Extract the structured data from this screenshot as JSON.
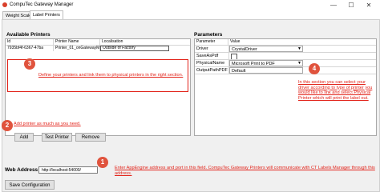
{
  "window": {
    "title": "CompuTec Gateway Manager",
    "minimize": "—",
    "maximize": "☐",
    "close": "✕"
  },
  "tabs": [
    {
      "label": "Weight Scales"
    },
    {
      "label": "Label Printers"
    }
  ],
  "available_printers": {
    "title": "Available Printers",
    "columns": [
      "Id",
      "Printer Name",
      "Localisation"
    ],
    "rows": [
      {
        "id": "7935bf4f-6367-47ba",
        "name": "Printer_01_onGatewayMachine",
        "localisation": "Outside of Factory"
      }
    ]
  },
  "parameters": {
    "title": "Parameters",
    "columns": [
      "Parameter",
      "Value"
    ],
    "rows": [
      {
        "name": "Driver",
        "value": "CrystalDriver"
      },
      {
        "name": "SaveAsPdf",
        "value": ""
      },
      {
        "name": "PhysicalName",
        "value": "Microsoft Print to PDF"
      },
      {
        "name": "OutputPathPDF",
        "value": "Default"
      }
    ]
  },
  "annotations": {
    "badge1": "1",
    "badge2": "2",
    "badge3": "3",
    "badge4": "4",
    "note3": "Define your printers and link them to physical printers in the right section.",
    "note2": "Add printer as much as you need.",
    "note4": "In this section you can select your driver according to type of printer you would like to link and select Physical Printer which will print the label out.",
    "note1": "Enter AppEngine address and port in this field. CompuTec Gateway Printers will communicate with CT Labels Manager through this address."
  },
  "buttons": {
    "add": "Add",
    "test_printer": "Test Printer",
    "remove": "Remove",
    "save_configuration": "Save Configuration"
  },
  "web_address": {
    "label": "Web Address",
    "value": "http://localhost:54000/"
  }
}
